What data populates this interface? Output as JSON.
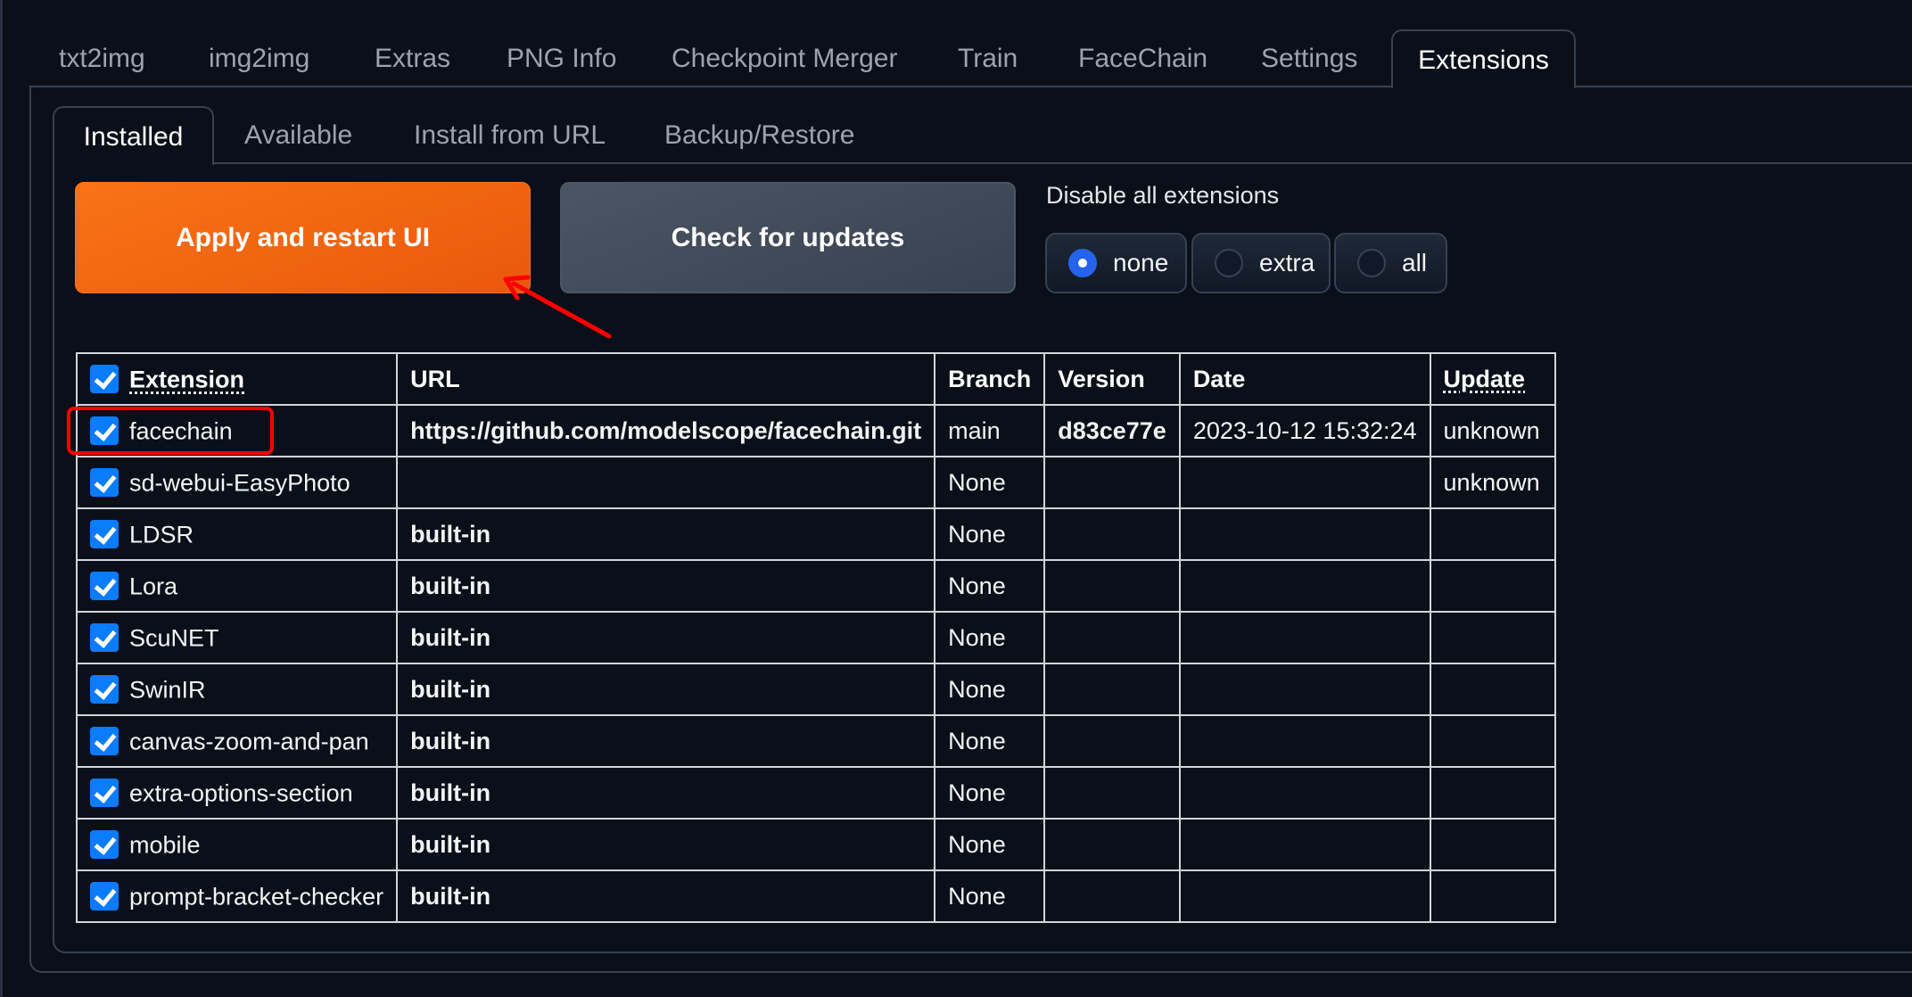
{
  "top_tabs": [
    {
      "label": "txt2img",
      "active": false
    },
    {
      "label": "img2img",
      "active": false
    },
    {
      "label": "Extras",
      "active": false
    },
    {
      "label": "PNG Info",
      "active": false
    },
    {
      "label": "Checkpoint Merger",
      "active": false
    },
    {
      "label": "Train",
      "active": false
    },
    {
      "label": "FaceChain",
      "active": false
    },
    {
      "label": "Settings",
      "active": false
    },
    {
      "label": "Extensions",
      "active": true
    }
  ],
  "inner_tabs": [
    {
      "label": "Installed",
      "active": true
    },
    {
      "label": "Available",
      "active": false
    },
    {
      "label": "Install from URL",
      "active": false
    },
    {
      "label": "Backup/Restore",
      "active": false
    }
  ],
  "buttons": {
    "apply": "Apply and restart UI",
    "check": "Check for updates"
  },
  "disable": {
    "label": "Disable all extensions",
    "options": [
      "none",
      "extra",
      "all"
    ],
    "selected": "none"
  },
  "table": {
    "columns": [
      "Extension",
      "URL",
      "Branch",
      "Version",
      "Date",
      "Update"
    ],
    "header_checked": true,
    "rows": [
      {
        "name": "facechain",
        "checked": true,
        "url": "https://github.com/modelscope/facechain.git",
        "branch": "main",
        "version": "d83ce77e",
        "date": "2023-10-12 15:32:24",
        "update": "unknown"
      },
      {
        "name": "sd-webui-EasyPhoto",
        "checked": true,
        "url": "",
        "branch": "None",
        "version": "",
        "date": "",
        "update": "unknown"
      },
      {
        "name": "LDSR",
        "checked": true,
        "url": "built-in",
        "branch": "None",
        "version": "",
        "date": "",
        "update": ""
      },
      {
        "name": "Lora",
        "checked": true,
        "url": "built-in",
        "branch": "None",
        "version": "",
        "date": "",
        "update": ""
      },
      {
        "name": "ScuNET",
        "checked": true,
        "url": "built-in",
        "branch": "None",
        "version": "",
        "date": "",
        "update": ""
      },
      {
        "name": "SwinIR",
        "checked": true,
        "url": "built-in",
        "branch": "None",
        "version": "",
        "date": "",
        "update": ""
      },
      {
        "name": "canvas-zoom-and-pan",
        "checked": true,
        "url": "built-in",
        "branch": "None",
        "version": "",
        "date": "",
        "update": ""
      },
      {
        "name": "extra-options-section",
        "checked": true,
        "url": "built-in",
        "branch": "None",
        "version": "",
        "date": "",
        "update": ""
      },
      {
        "name": "mobile",
        "checked": true,
        "url": "built-in",
        "branch": "None",
        "version": "",
        "date": "",
        "update": ""
      },
      {
        "name": "prompt-bracket-checker",
        "checked": true,
        "url": "built-in",
        "branch": "None",
        "version": "",
        "date": "",
        "update": ""
      }
    ]
  },
  "annotations": {
    "highlight_color": "#ff0000",
    "highlight_target": "facechain",
    "arrow_target": "Apply and restart UI"
  },
  "colors": {
    "background": "#0b0f19",
    "accent_orange": "#f97316",
    "checkbox_blue": "#0a7cff",
    "radio_blue": "#2563eb"
  }
}
